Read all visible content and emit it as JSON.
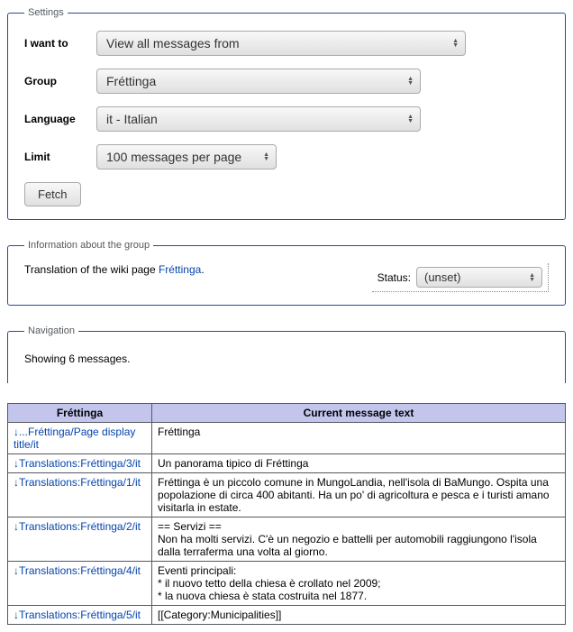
{
  "settings": {
    "legend": "Settings",
    "iwantto_label": "I want to",
    "iwantto_value": "View all messages from",
    "group_label": "Group",
    "group_value": "Fréttinga",
    "language_label": "Language",
    "language_value": "it - Italian",
    "limit_label": "Limit",
    "limit_value": "100 messages per page",
    "fetch_label": "Fetch"
  },
  "info": {
    "legend": "Information about the group",
    "text_prefix": "Translation of the wiki page ",
    "link_text": "Fréttinga",
    "text_suffix": ".",
    "status_label": "Status:",
    "status_value": "(unset)"
  },
  "nav": {
    "legend": "Navigation",
    "showing": "Showing 6 messages."
  },
  "table": {
    "col1": "Fréttinga",
    "col2": "Current message text",
    "rows": [
      {
        "key": "...Fréttinga/Page display title/it",
        "msg": "Fréttinga"
      },
      {
        "key": "Translations:Fréttinga/3/it",
        "msg": "Un panorama tipico di Fréttinga"
      },
      {
        "key": "Translations:Fréttinga/1/it",
        "msg": "Fréttinga è un piccolo comune in MungoLandia, nell'isola di BaMungo. Ospita una popolazione di circa 400 abitanti. Ha un po' di agricoltura e pesca e i turisti amano visitarla in estate."
      },
      {
        "key": "Translations:Fréttinga/2/it",
        "msg": "== Servizi ==\nNon ha molti servizi. C'è un negozio e battelli per automobili raggiungono l'isola dalla terraferma una volta al giorno."
      },
      {
        "key": "Translations:Fréttinga/4/it",
        "msg": "Eventi principali:\n* il nuovo tetto della chiesa è crollato nel 2009;\n* la nuova chiesa è stata costruita nel 1877."
      },
      {
        "key": "Translations:Fréttinga/5/it",
        "msg": "[[Category:Municipalities]]"
      }
    ]
  }
}
